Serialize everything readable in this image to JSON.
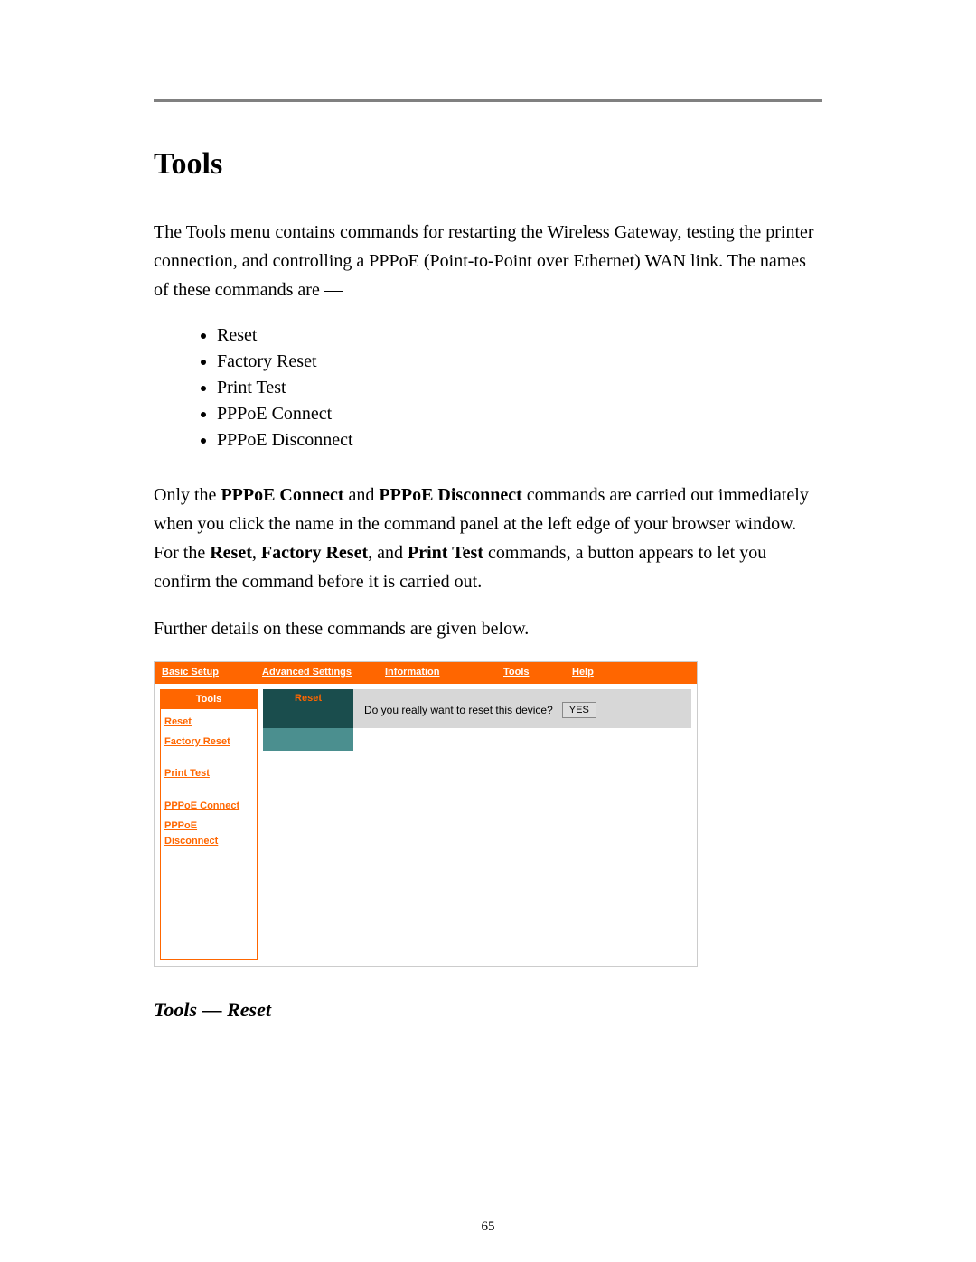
{
  "heading": "Tools",
  "intro1": "The Tools menu contains commands for restarting the Wireless Gateway, testing the printer connection, and controlling a PPPoE (Point-to-Point over Ethernet) WAN link. The names of these commands are  —",
  "commands": [
    "Reset",
    "Factory Reset",
    "Print Test",
    "PPPoE Connect",
    "PPPoE Disconnect"
  ],
  "para2": {
    "p0": "Only the ",
    "b1": "PPPoE Connect",
    "p1": " and ",
    "b2": "PPPoE Disconnect",
    "p2": " commands are carried out immediately when you click the name in the command panel at the left edge of your browser window. For the ",
    "b3": "Reset",
    "p3": ", ",
    "b4": "Factory Reset",
    "p4": ", and ",
    "b5": "Print Test",
    "p5": " commands, a button appears to let you confirm the command before it is carried out."
  },
  "para3": "Further details on these commands are given below.",
  "router": {
    "nav": {
      "basic_setup": "Basic Setup",
      "advanced_settings": "Advanced Settings",
      "information": "Information",
      "tools": "Tools",
      "help": "Help"
    },
    "sidebar": {
      "title": "Tools",
      "reset": "Reset",
      "factory_reset": "Factory Reset",
      "print_test": "Print Test",
      "pppoe_connect": "PPPoE Connect",
      "pppoe_disconnect": "PPPoE Disconnect"
    },
    "main": {
      "tab": "Reset",
      "prompt": "Do you really want to reset this device?",
      "yes": "YES"
    }
  },
  "subheading": "Tools  — Reset",
  "page_number": "65"
}
